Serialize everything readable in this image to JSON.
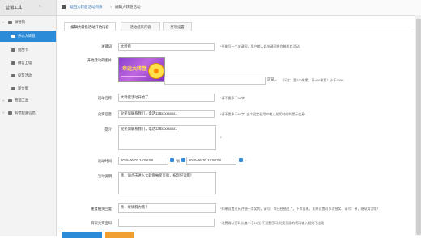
{
  "sidebar": {
    "header": "营销工具",
    "items": [
      {
        "label": "微营销",
        "level": 1,
        "toggle": "−"
      },
      {
        "label": "开心大转盘",
        "level": 2,
        "active": true
      },
      {
        "label": "刮刮卡",
        "level": 2
      },
      {
        "label": "微信上墙",
        "level": 2
      },
      {
        "label": "投票活动",
        "level": 2
      },
      {
        "label": "现金蛋",
        "level": 2
      },
      {
        "label": "营销工具",
        "level": 1,
        "toggle": "+"
      },
      {
        "label": "其他配置信息",
        "level": 1,
        "toggle": "+"
      }
    ]
  },
  "breadcrumb": {
    "items": [
      "返回大转盘活动列表",
      "编辑大转盘活动"
    ]
  },
  "tabs": [
    {
      "label": "编辑大转盘活动开始内容",
      "active": true
    },
    {
      "label": "活动结束内容"
    },
    {
      "label": "奖项设置"
    }
  ],
  "form": {
    "keyword": {
      "label": "关键词",
      "value": "大转盘",
      "hint": "*只能写一个关键词，用户输入此关键词将会触发此活动。"
    },
    "image": {
      "label": "开始活动的图片",
      "title": "幸运大转盘",
      "browse": "浏览...",
      "hint": "（尺寸：宽720像素，高400像素）小于200K"
    },
    "name": {
      "label": "活动名称",
      "value": "大转盘活动开始了",
      "hint": "*请不要多于50字!"
    },
    "exchange": {
      "label": "兑奖信息",
      "value": "兑奖请联系我们，电话138xxxxxxxx1",
      "hint": "*请不要多于50字! 这个设定但用户输入兑奖时候的提示信息!"
    },
    "intro": {
      "label": "简介",
      "value": "兑奖请联系我们，电话138xxxxxxxx1",
      "hint": "*"
    },
    "time": {
      "label": "活动时间",
      "start": "2015-06-07 16:50:58",
      "sep": "到",
      "end": "2015-06-30 16:50:58",
      "hint": "*"
    },
    "desc": {
      "label": "活动说明",
      "value": "亲，请点击进入大转盘抽奖页面，祝您好运哦！"
    },
    "repeat": {
      "label": "重复抽奖回复",
      "value": "亲，继续努力哦！",
      "hint": "*如果设置只允许抽一次奖的，请写：你已经抽过了，下次再来。如果设置可多次抽奖，请写：亲，继续努力哦！"
    },
    "password": {
      "label": "商家兑奖密码",
      "value": "",
      "hint": "*消费确认密码长度小于15位 不设置密码,兑奖页面的密码输入框则不出现"
    }
  }
}
